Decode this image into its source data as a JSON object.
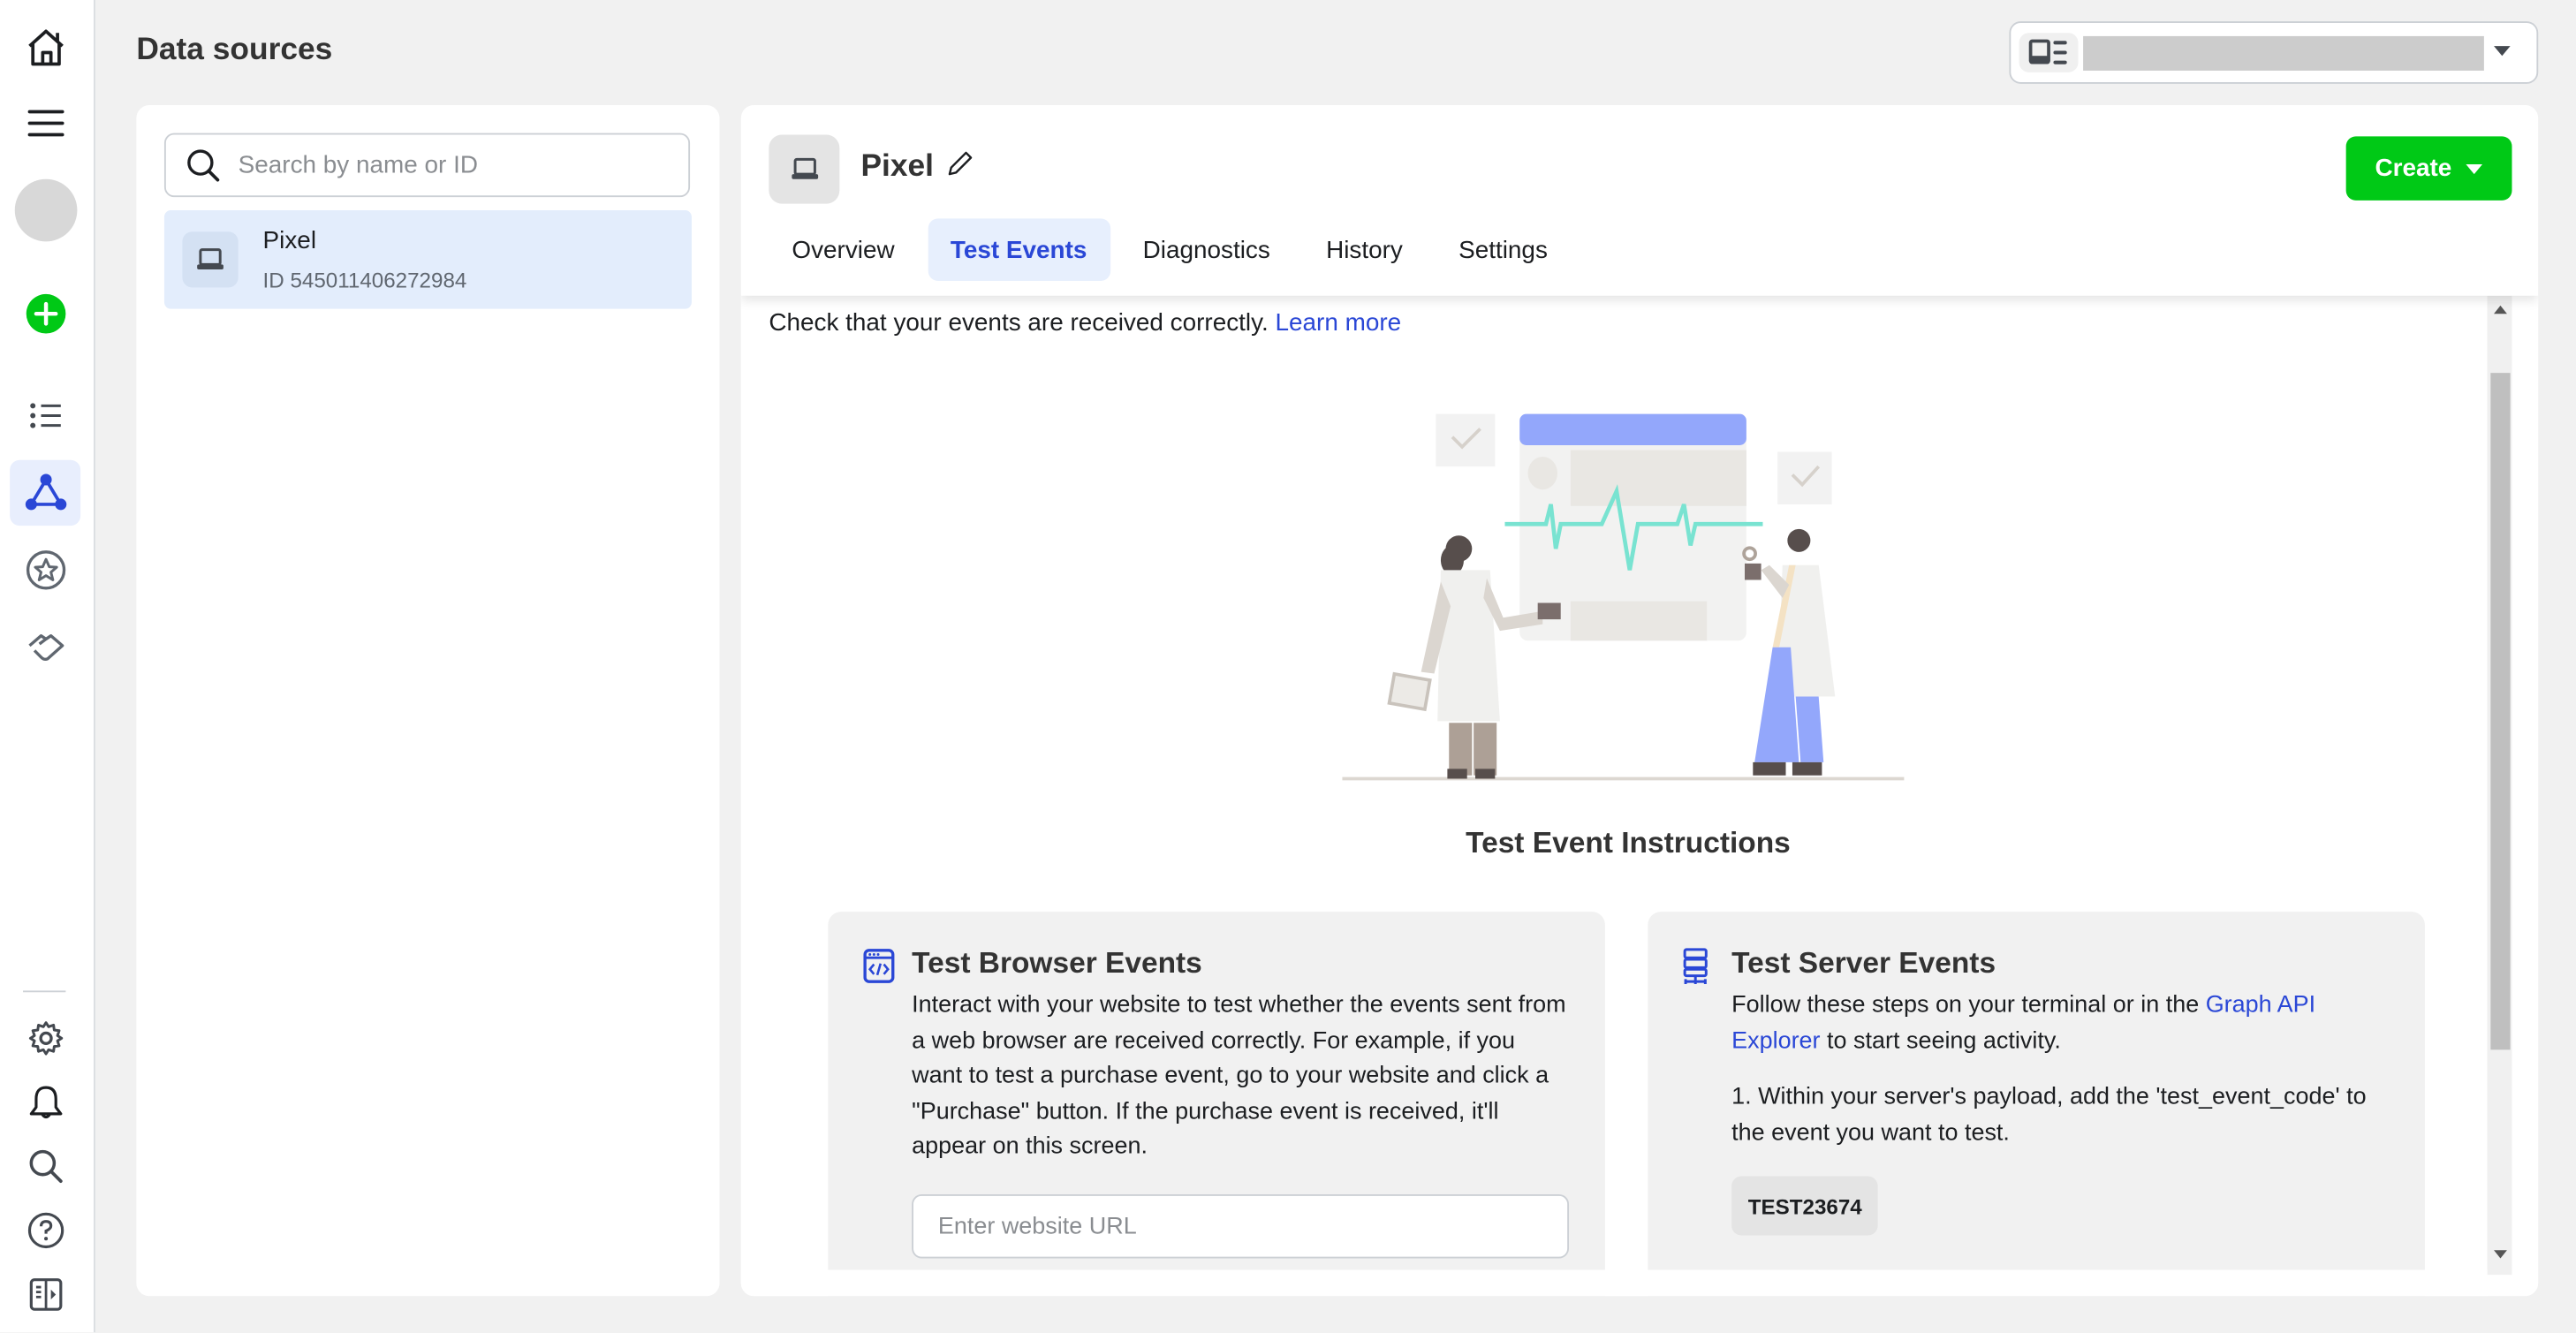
{
  "page": {
    "title": "Data sources"
  },
  "rail": {
    "icons": [
      "home-icon",
      "menu-icon",
      "avatar",
      "create-icon",
      "list-icon",
      "data-sources-icon",
      "star-icon",
      "handshake-icon",
      "settings-icon",
      "notifications-icon",
      "search-icon",
      "help-icon",
      "panel-toggle-icon"
    ],
    "active": "data-sources-icon",
    "accent": "#2a47d6",
    "create_color": "#00c916"
  },
  "account_selector": {
    "icon": "business-icon",
    "value": ""
  },
  "left_panel": {
    "search": {
      "placeholder": "Search by name or ID",
      "value": ""
    },
    "items": [
      {
        "name": "Pixel",
        "id": "ID 545011406272984",
        "icon": "laptop-icon",
        "selected": true
      }
    ]
  },
  "main": {
    "title": "Pixel",
    "create_label": "Create",
    "tabs": [
      {
        "label": "Overview",
        "active": false
      },
      {
        "label": "Test Events",
        "active": true
      },
      {
        "label": "Diagnostics",
        "active": false
      },
      {
        "label": "History",
        "active": false
      },
      {
        "label": "Settings",
        "active": false
      }
    ],
    "intro": "Check that your events are received correctly.",
    "learn_more": "Learn more",
    "instructions_title": "Test Event Instructions",
    "browser_card": {
      "title": "Test Browser Events",
      "body": "Interact with your website to test whether the events sent from a web browser are received correctly. For example, if you want to test a purchase event, go to your website and click a \"Purchase\" button. If the purchase event is received, it'll appear on this screen.",
      "url_placeholder": "Enter website URL",
      "url_value": ""
    },
    "server_card": {
      "title": "Test Server Events",
      "body_prefix": "Follow these steps on your terminal or in the",
      "body_link": "Graph API Explorer",
      "body_suffix": "to start seeing activity.",
      "step1": "1. Within your server's payload, add the 'test_event_code' to the event you want to test.",
      "code": "TEST23674"
    }
  }
}
